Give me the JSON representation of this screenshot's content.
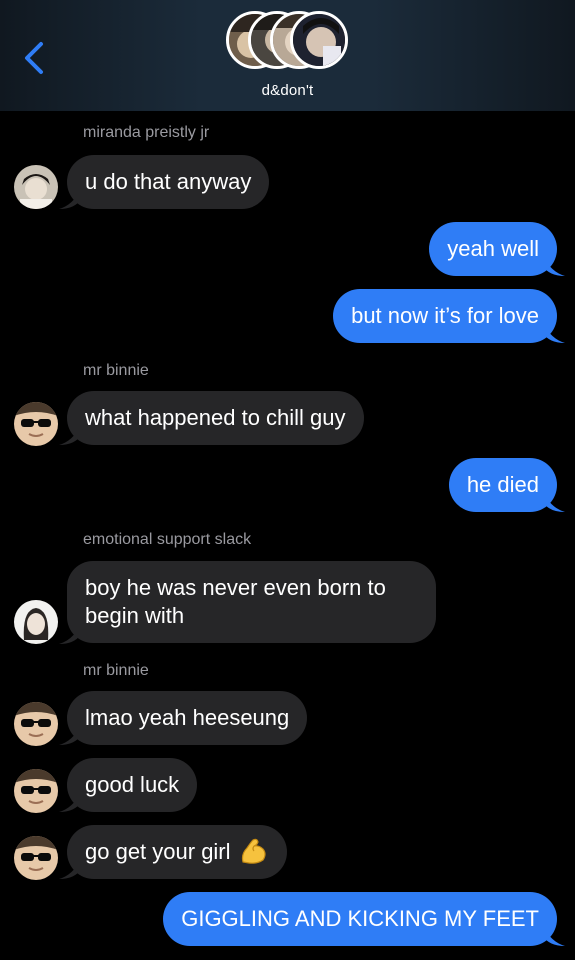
{
  "header": {
    "title": "d&don't",
    "back_icon": "chevron-left-icon",
    "accent": "#2f7df6"
  },
  "messages": [
    {
      "type": "in",
      "sender": "miranda preistly jr",
      "text": "u do that anyway",
      "avatar": "dark-hair-avatar"
    },
    {
      "type": "out",
      "text": "yeah well"
    },
    {
      "type": "out",
      "text": "but now it’s for love"
    },
    {
      "type": "in",
      "sender": "mr binnie",
      "text": "what happened to chill guy",
      "avatar": "sunglasses-avatar"
    },
    {
      "type": "out",
      "text": "he died"
    },
    {
      "type": "in",
      "sender": "emotional support slack",
      "text": "boy he was never even born to begin with",
      "line1": "boy he was never even born to",
      "line2": "begin with",
      "avatar": "light-avatar"
    },
    {
      "type": "in",
      "sender": "mr binnie",
      "text": "lmao yeah heeseung",
      "avatar": "sunglasses-avatar"
    },
    {
      "type": "in",
      "text": "good luck",
      "avatar": "sunglasses-avatar"
    },
    {
      "type": "in",
      "text": "go get your girl",
      "emoji": "flexed-biceps",
      "avatar": "sunglasses-avatar"
    },
    {
      "type": "out",
      "text": "GIGGLING AND KICKING MY FEET"
    }
  ],
  "colors": {
    "incoming_bubble": "#262628",
    "outgoing_bubble": "#2f7df6",
    "background": "#000000",
    "sender_label": "#9a9aa0"
  }
}
